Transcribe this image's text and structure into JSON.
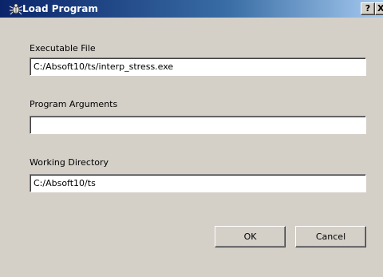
{
  "window": {
    "title": "Load Program",
    "help_label": "?",
    "close_label": "X"
  },
  "executable": {
    "label": "Executable File",
    "value": "C:/Absoft10/ts/interp_stress.exe"
  },
  "arguments": {
    "label": "Program Arguments",
    "value": ""
  },
  "working_dir": {
    "label": "Working Directory",
    "value": "C:/Absoft10/ts"
  },
  "buttons": {
    "ok_label": "OK",
    "cancel_label": "Cancel"
  },
  "icons": {
    "title_icon": "bug-icon"
  },
  "colors": {
    "titlebar_start": "#0a246a",
    "titlebar_end": "#a6caf0",
    "dialog_background": "#d4d0c8"
  }
}
